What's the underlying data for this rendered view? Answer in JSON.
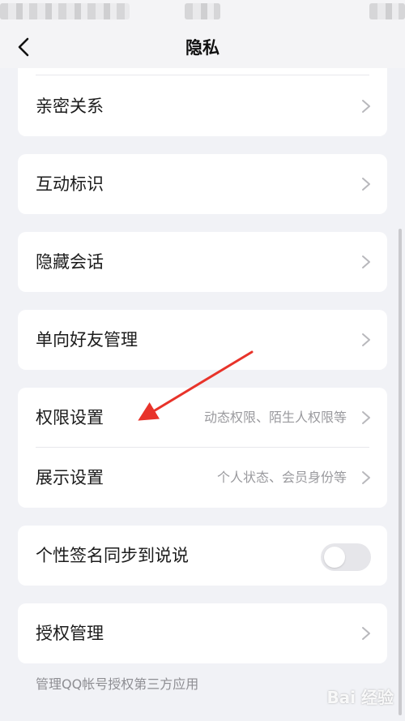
{
  "nav": {
    "title": "隐私"
  },
  "cards": {
    "intimate": {
      "label": "亲密关系"
    },
    "interaction": {
      "label": "互动标识"
    },
    "hidden_chat": {
      "label": "隐藏会话"
    },
    "one_way": {
      "label": "单向好友管理"
    },
    "permission": {
      "label": "权限设置",
      "value": "动态权限、陌生人权限等"
    },
    "display": {
      "label": "展示设置",
      "value": "个人状态、会员身份等"
    },
    "signature_sync": {
      "label": "个性签名同步到说说",
      "enabled": false
    },
    "authorization": {
      "label": "授权管理"
    }
  },
  "footnote": "管理QQ帐号授权第三方应用",
  "watermark": "Bai 经验",
  "colors": {
    "background": "#f1f2f6",
    "card": "#ffffff",
    "annotation_arrow": "#e8332a"
  },
  "icons": [
    "back-icon",
    "chevron-right-icon"
  ]
}
